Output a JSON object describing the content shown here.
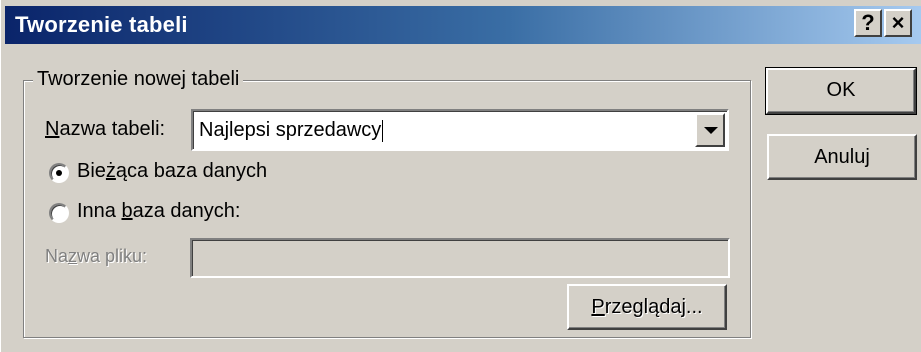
{
  "dialog": {
    "title": "Tworzenie tabeli",
    "help_button": "?",
    "close_button": "×"
  },
  "group": {
    "legend": "Tworzenie nowej tabeli",
    "table_name_label_prefix": "",
    "table_name_label_hotkey": "N",
    "table_name_label_rest": "azwa tabeli:",
    "table_name_value": "Najlepsi sprzedawcy",
    "radio_current": {
      "pre": "Bie",
      "hotkey": "ż",
      "post": "ąca baza danych",
      "checked": true
    },
    "radio_other": {
      "pre": "Inna ",
      "hotkey": "b",
      "post": "aza danych:",
      "checked": false
    },
    "file_label_pre": "Na",
    "file_label_hotkey": "z",
    "file_label_post": "wa pliku:",
    "file_value": "",
    "browse_pre": "",
    "browse_hotkey": "P",
    "browse_post": "rzeglądaj..."
  },
  "buttons": {
    "ok": "OK",
    "cancel": "Anuluj"
  }
}
